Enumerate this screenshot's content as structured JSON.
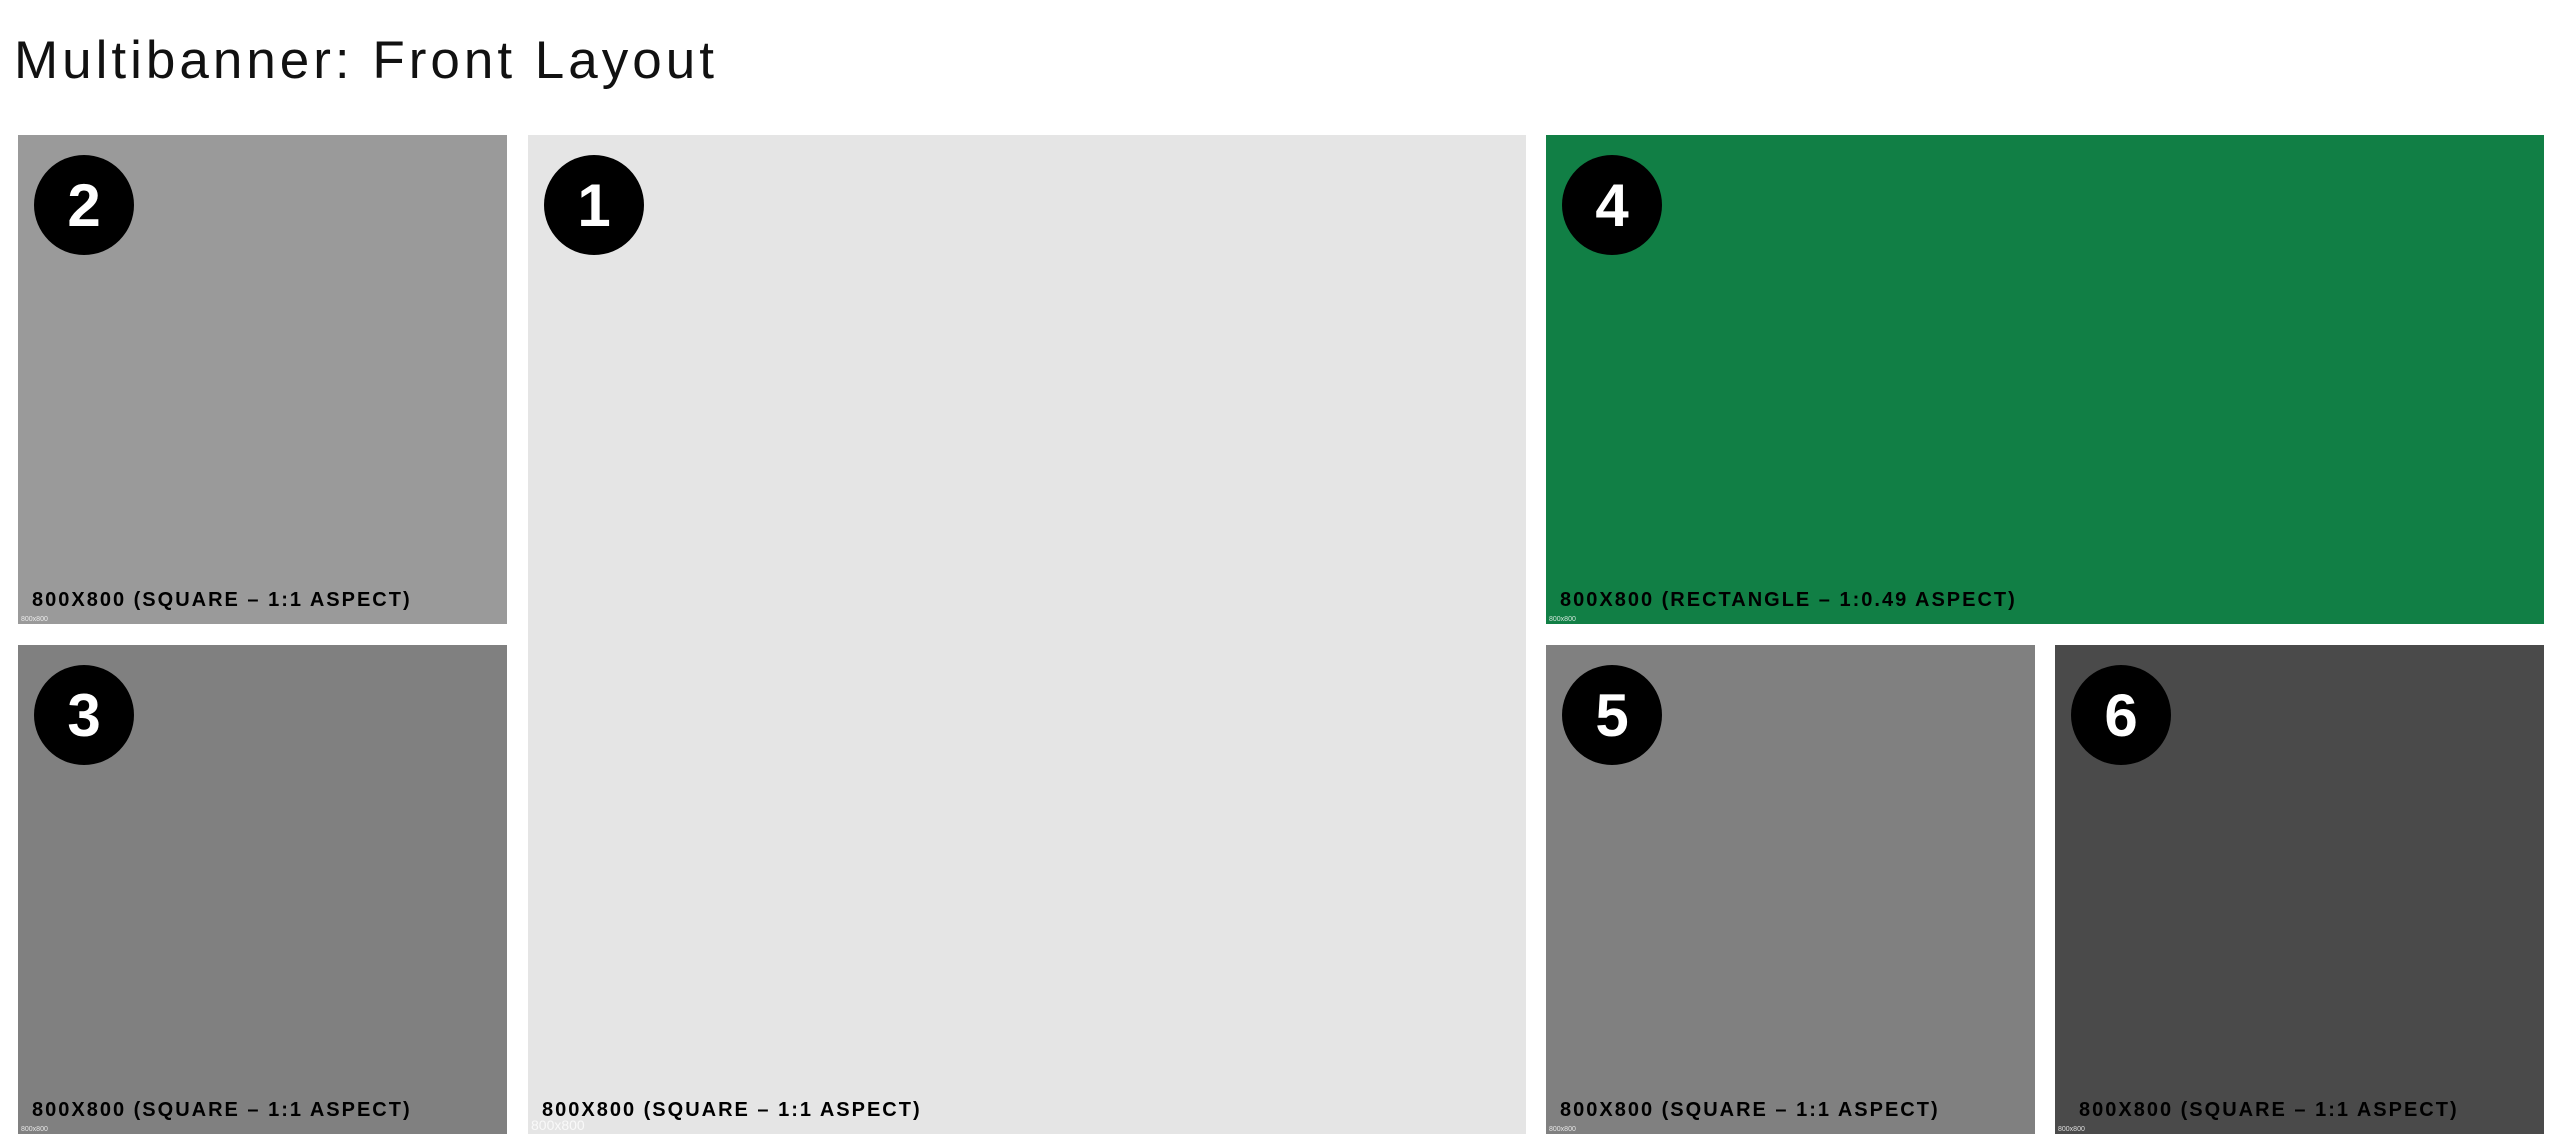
{
  "page": {
    "title": "Multibanner: Front Layout"
  },
  "tiles": {
    "t1": {
      "number": "1",
      "caption": "800X800 (SQUARE – 1:1 ASPECT)",
      "size_mark": "800x800",
      "color": "#e5e5e5"
    },
    "t2": {
      "number": "2",
      "caption": "800X800 (SQUARE – 1:1 ASPECT)",
      "size_mark": "800x800",
      "color": "#9a9a9a"
    },
    "t3": {
      "number": "3",
      "caption": "800X800 (SQUARE – 1:1 ASPECT)",
      "size_mark": "800x800",
      "color": "#808080"
    },
    "t4": {
      "number": "4",
      "caption": "800X800 (RECTANGLE – 1:0.49 ASPECT)",
      "size_mark": "800x800",
      "color": "#117f45"
    },
    "t5": {
      "number": "5",
      "caption": "800X800 (SQUARE – 1:1 ASPECT)",
      "size_mark": "800x800",
      "color": "#808080"
    },
    "t6": {
      "number": "6",
      "caption": "800X800 (SQUARE – 1:1 ASPECT)",
      "size_mark": "800x800",
      "color": "#4a4a4a"
    }
  }
}
